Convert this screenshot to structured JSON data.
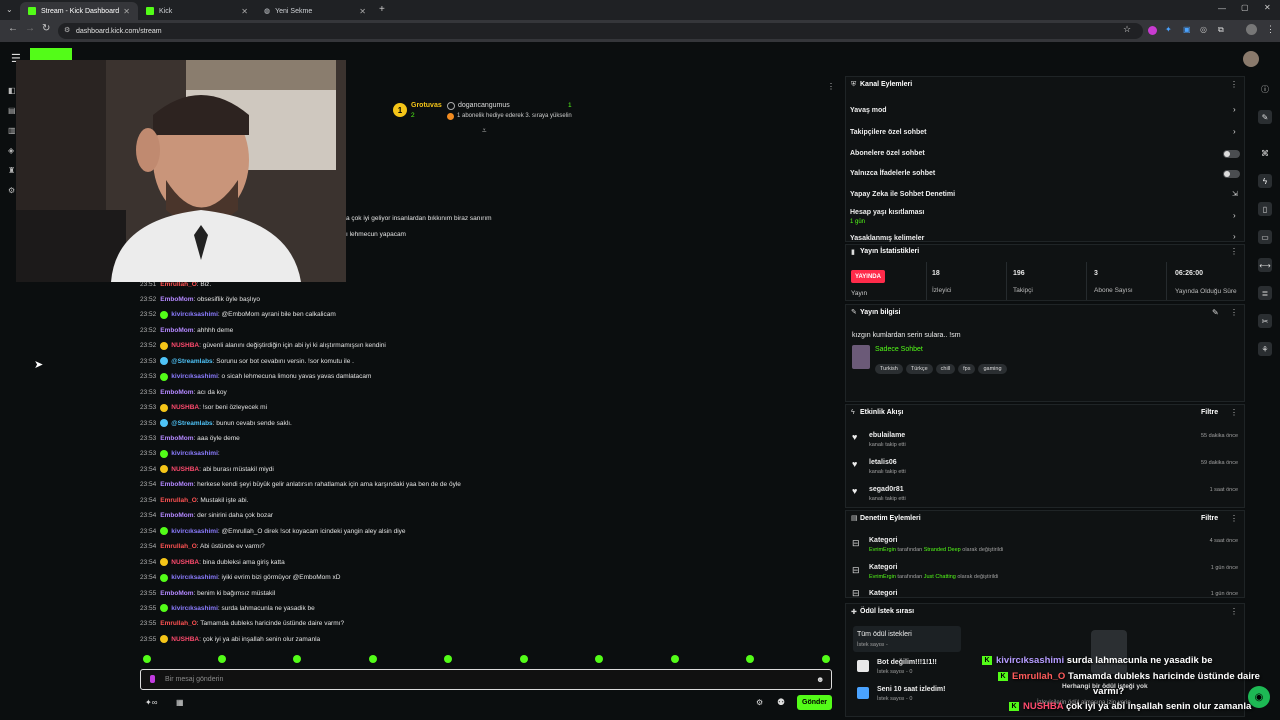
{
  "browser": {
    "tabs": [
      {
        "label": "Stream - Kick Dashboard",
        "active": true
      },
      {
        "label": "Kick",
        "active": false
      },
      {
        "label": "Yeni Sekme",
        "active": false
      }
    ],
    "url": "dashboard.kick.com/stream"
  },
  "top_notice": {
    "user": "Grotuvas",
    "count_left": "2",
    "gifter": "dogancangumus",
    "count_right": "1",
    "message": "1 abonelik hediye ederek 3. sıraya yükselin"
  },
  "chat_partial": [
    "a çok iyi geliyor insanlardan bıkkınım biraz sanırım",
    "ı lehmecun yapacam"
  ],
  "chat": [
    {
      "time": "23:51",
      "user": "Emrullah_O",
      "color": "#ff5252",
      "text": ": Biz."
    },
    {
      "time": "23:52",
      "user": "EmboMom",
      "color": "#b488ff",
      "text": ": obsesiflik öyle başlıyo"
    },
    {
      "time": "23:52",
      "user": "kivircıksashimi",
      "color": "#8c7cff",
      "text": ": @EmboMom ayrani bile ben calkalicam"
    },
    {
      "time": "23:52",
      "user": "EmboMom",
      "color": "#b488ff",
      "text": ": ahhhh deme"
    },
    {
      "time": "23:52",
      "user": "NUSHBA",
      "color": "#ff4b6e",
      "text": ": güvenli alanını değiştirdiğin için abi iyi ki alıştırmamışsın kendini"
    },
    {
      "time": "23:53",
      "user": "@Streamlabs",
      "color": "#4fc3f7",
      "text": ": Sorunu sor bot cevabını versin. !sor komutu ile ."
    },
    {
      "time": "23:53",
      "user": "kivircıksashimi",
      "color": "#8c7cff",
      "text": ": o sicah lehmecuna limonu yavas yavas damlatacam"
    },
    {
      "time": "23:53",
      "user": "EmboMom",
      "color": "#b488ff",
      "text": ": acı da koy"
    },
    {
      "time": "23:53",
      "user": "NUSHBA",
      "color": "#ff4b6e",
      "text": ": !sor beni özleyecek mi"
    },
    {
      "time": "23:53",
      "user": "@Streamlabs",
      "color": "#4fc3f7",
      "text": ": bunun cevabı sende saklı."
    },
    {
      "time": "23:53",
      "user": "EmboMom",
      "color": "#b488ff",
      "text": ": aaa öyle deme"
    },
    {
      "time": "23:53",
      "user": "kivircıksashimi",
      "color": "#8c7cff",
      "text": ":"
    },
    {
      "time": "23:54",
      "user": "NUSHBA",
      "color": "#ff4b6e",
      "text": ": abi burası müstakil miydi"
    },
    {
      "time": "23:54",
      "user": "EmboMom",
      "color": "#b488ff",
      "text": ": herkese kendi şeyi büyük gelir anlatırsın rahatlamak için ama karşındaki yaa ben de de öyle"
    },
    {
      "time": "23:54",
      "user": "Emrullah_O",
      "color": "#ff5252",
      "text": ": Mustakil işte abi."
    },
    {
      "time": "23:54",
      "user": "EmboMom",
      "color": "#b488ff",
      "text": ": der sinirini daha çok bozar"
    },
    {
      "time": "23:54",
      "user": "kivircıksashimi",
      "color": "#8c7cff",
      "text": ": @Emrullah_O direk !sot koyacam icindeki yangin aley alsin diye"
    },
    {
      "time": "23:54",
      "user": "Emrullah_O",
      "color": "#ff5252",
      "text": ": Abi üstünde ev varmı?"
    },
    {
      "time": "23:54",
      "user": "NUSHBA",
      "color": "#ff4b6e",
      "text": ": bina dubleksi ama giriş katta"
    },
    {
      "time": "23:54",
      "user": "kivircıksashimi",
      "color": "#8c7cff",
      "text": ": iyiki evrim bizi görmüyor @EmboMom xD"
    },
    {
      "time": "23:55",
      "user": "EmboMom",
      "color": "#b488ff",
      "text": ": benim ki bağımsız müstakil"
    },
    {
      "time": "23:55",
      "user": "kivircıksashimi",
      "color": "#8c7cff",
      "text": ": surda lahmacunla ne yasadik be"
    },
    {
      "time": "23:55",
      "user": "Emrullah_O",
      "color": "#ff5252",
      "text": ": Tamamda dubleks haricinde üstünde daire varmı?"
    },
    {
      "time": "23:55",
      "user": "NUSHBA",
      "color": "#ff4b6e",
      "text": ": çok iyi ya abi inşallah senin olur zamanla"
    }
  ],
  "chat_input": {
    "placeholder": "Bir mesaj gönderin",
    "send_label": "Gönder"
  },
  "channel_actions": {
    "title": "Kanal Eylemleri",
    "items": [
      {
        "label": "Yavaş mod",
        "control": "chevron"
      },
      {
        "label": "Takipçilere özel sohbet",
        "control": "chevron"
      },
      {
        "label": "Abonelere özel sohbet",
        "control": "toggle"
      },
      {
        "label": "Yalnızca İfadelerle sohbet",
        "control": "toggle"
      },
      {
        "label": "Yapay Zeka ile Sohbet Denetimi",
        "control": "link"
      },
      {
        "label": "Hesap yaşı kısıtlaması",
        "sub": "1 gün",
        "control": "chevron"
      },
      {
        "label": "Yasaklanmış kelimeler",
        "control": "chevron"
      }
    ]
  },
  "stream_stats": {
    "title": "Yayın İstatistikleri",
    "live_label": "YAYINDA",
    "live_caption": "Yayın",
    "stats": [
      {
        "value": "18",
        "label": "İzleyici"
      },
      {
        "value": "196",
        "label": "Takipçi"
      },
      {
        "value": "3",
        "label": "Abone Sayısı"
      },
      {
        "value": "06:26:00",
        "label": "Yayında Olduğu Süre"
      }
    ]
  },
  "stream_info": {
    "title": "Yayın bilgisi",
    "stream_title": "kızgın kumlardan serin sulara.. !sm",
    "category": "Sadece Sohbet",
    "tags": [
      "Turkish",
      "Türkçe",
      "chill",
      "fps",
      "gaming"
    ]
  },
  "activity": {
    "title": "Etkinlik Akışı",
    "filter_label": "Filtre",
    "items": [
      {
        "user": "ebulailame",
        "action": "kanalı takip etti",
        "time": "55 dakika önce"
      },
      {
        "user": "letalis06",
        "action": "kanalı takip etti",
        "time": "59 dakika önce"
      },
      {
        "user": "segad0r81",
        "action": "kanalı takip etti",
        "time": "1 saat önce"
      }
    ]
  },
  "moderation": {
    "title": "Denetim Eylemleri",
    "filter_label": "Filtre",
    "items": [
      {
        "title": "Kategori",
        "actor": "EvrimErgin",
        "mid": " tarafından ",
        "target": "Stranded Deep",
        "tail": " olarak değiştirildi",
        "time": "4 saat önce"
      },
      {
        "title": "Kategori",
        "actor": "EvrimErgin",
        "mid": " tarafından ",
        "target": "Just Chatting",
        "tail": " olarak değiştirildi",
        "time": "1 gün önce"
      },
      {
        "title": "Kategori",
        "time": "1 gün önce"
      }
    ]
  },
  "rewards": {
    "title": "Ödül İstek sırası",
    "all_label": "Tüm ödül istekleri",
    "all_sub": "İstek sayısı -",
    "items": [
      {
        "title": "Bot değilim!!!1!1!!",
        "sub": "İstek sayısı - 0"
      },
      {
        "title": "Seni 10 saat izledim!",
        "sub": "İstek sayısı - 0"
      }
    ],
    "empty_title": "Herhangi bir ödül isteği yok",
    "empty_sub": "İzleyicilerin ödül almasına izin verin"
  },
  "overlay_chat": [
    {
      "user": "kivircıksashimi",
      "color": "#b59cff",
      "text": "surda lahmacunla ne yasadik be"
    },
    {
      "user": "Emrullah_O",
      "color": "#ff5b5b",
      "text": "Tamamda dubleks haricinde üstünde daire"
    },
    {
      "user": "",
      "color": "#ffffff",
      "text": "varmı?"
    },
    {
      "user": "NUSHBA",
      "color": "#ff4b6e",
      "text": "çok iyi ya abi inşallah senin olur zamanla"
    }
  ],
  "colors": {
    "accent": "#53fc18",
    "live": "#ff2b4a",
    "bg": "#0b0e0f"
  }
}
